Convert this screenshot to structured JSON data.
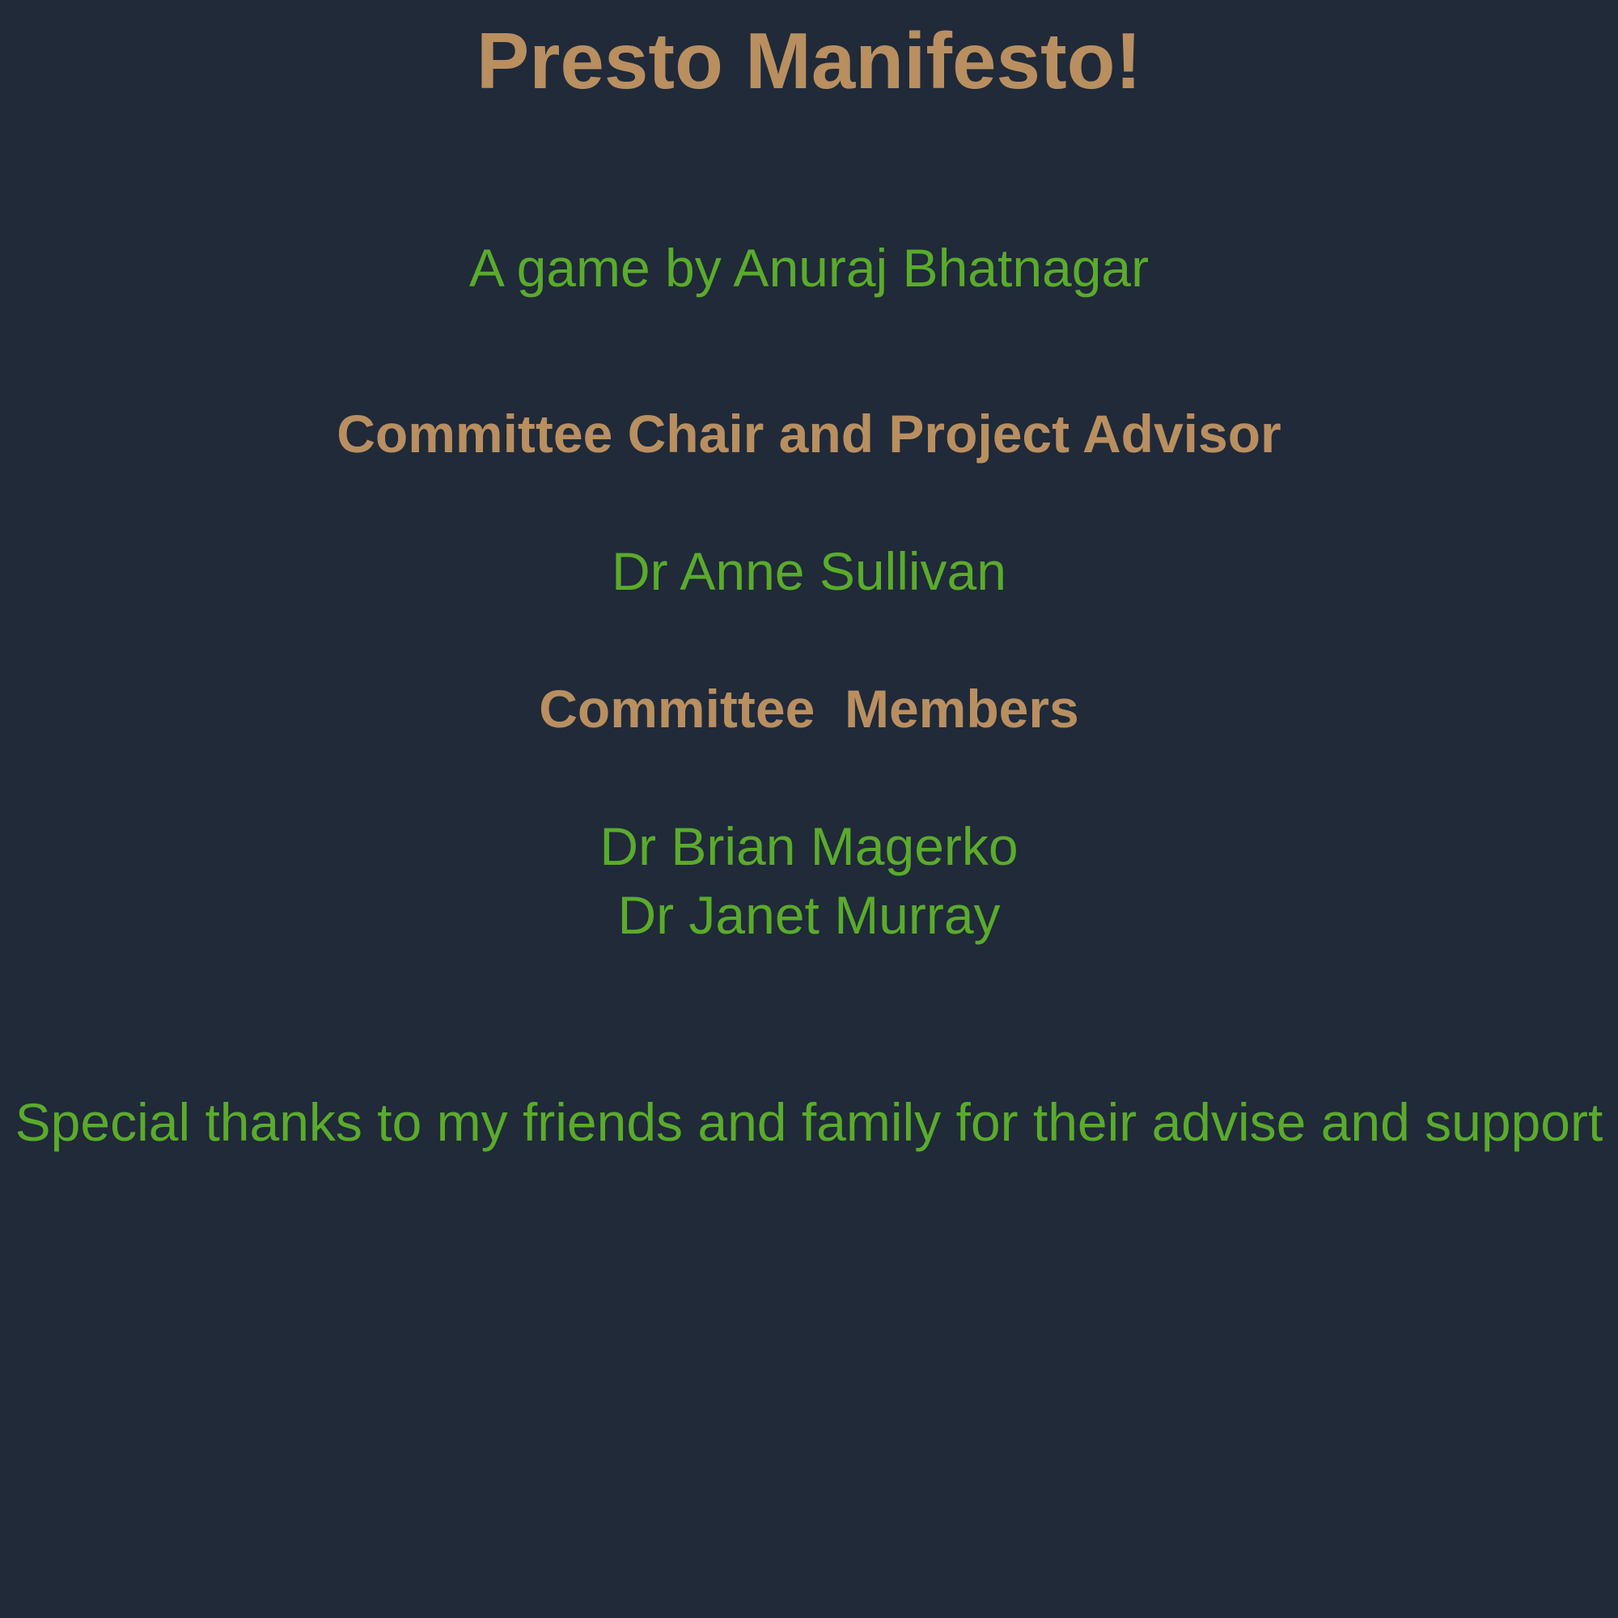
{
  "credits": {
    "title": "Presto Manifesto!",
    "byline": "A game by Anuraj Bhatnagar",
    "chair_heading": "Committee Chair and Project Advisor",
    "chair_name": "Dr Anne Sullivan",
    "members_heading": "Committee  Members",
    "members": [
      "Dr Brian Magerko",
      "Dr Janet Murray"
    ],
    "thanks": "Special thanks to my friends and family for their advise and support"
  },
  "colors": {
    "background": "#202a39",
    "heading": "#b98f60",
    "body_text": "#5aab2b"
  }
}
